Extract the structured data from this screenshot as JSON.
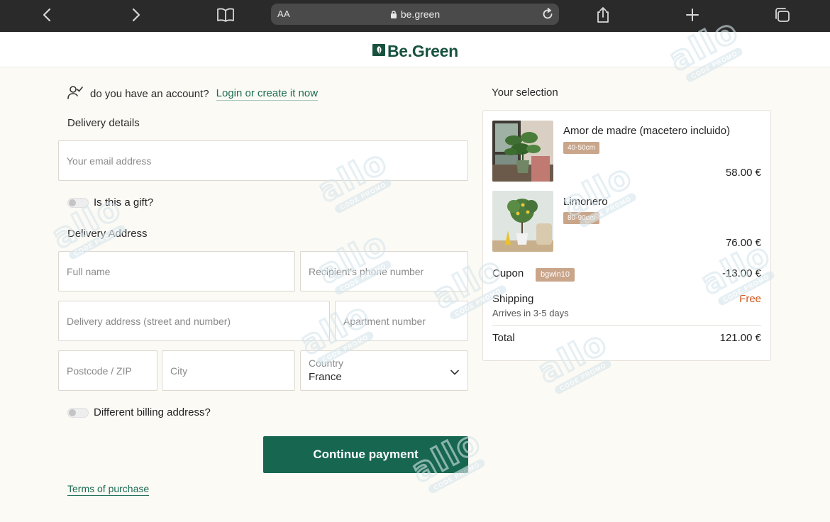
{
  "browser": {
    "text_size_label": "AA",
    "url": "be.green"
  },
  "header": {
    "logo_text": "Be.Green",
    "brand_color": "#17523f"
  },
  "account": {
    "question": "do you have an account?",
    "link": "Login or create it now"
  },
  "delivery_details": {
    "title": "Delivery details",
    "email_placeholder": "Your email address",
    "gift_label": "Is this a gift?"
  },
  "delivery_address": {
    "title": "Delivery Address",
    "full_name_placeholder": "Full name",
    "phone_placeholder": "Recipient's phone number",
    "street_placeholder": "Delivery address (street and number)",
    "apartment_placeholder": "Apartment number",
    "postcode_placeholder": "Postcode / ZIP",
    "city_placeholder": "City",
    "country_label": "Country",
    "country_value": "France"
  },
  "billing": {
    "different_label": "Different billing address?"
  },
  "actions": {
    "continue_label": "Continue payment",
    "button_color": "#166650",
    "terms_link": "Terms of purchase"
  },
  "selection": {
    "title": "Your selection",
    "items": [
      {
        "name": "Amor de madre (macetero incluido)",
        "size": "40-50cm",
        "price": "58.00 €"
      },
      {
        "name": "Limonero",
        "size": "80-90cm",
        "price": "76.00 €"
      }
    ],
    "coupon_label": "Cupon",
    "coupon_code": "bgwin10",
    "coupon_value": "-13.00 €",
    "shipping_label": "Shipping",
    "shipping_value": "Free",
    "shipping_eta": "Arrives in 3-5 days",
    "total_label": "Total",
    "total_value": "121.00 €"
  },
  "watermark": {
    "big": "allo",
    "small": "CODE PROMO"
  }
}
